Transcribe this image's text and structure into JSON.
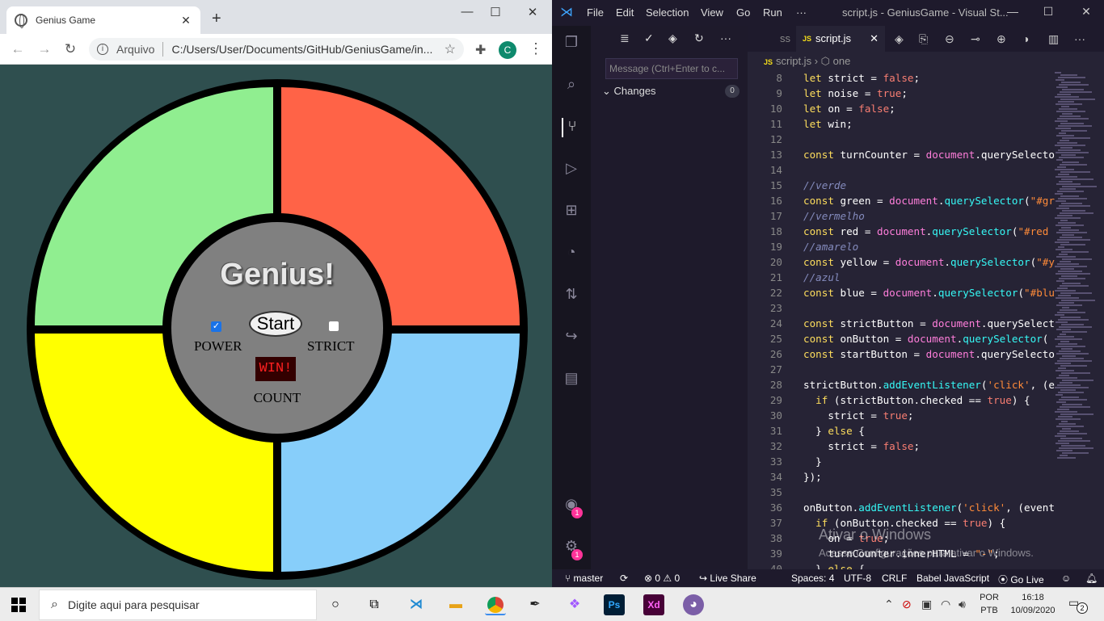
{
  "chrome": {
    "tab_title": "Genius Game",
    "address_scheme": "Arquivo",
    "address_url": "C:/Users/User/Documents/GitHub/GeniusGame/in...",
    "profile_initial": "C"
  },
  "game": {
    "title": "Genius!",
    "start_label": "Start",
    "power_label": "POWER",
    "strict_label": "STRICT",
    "count_display": "WIN!",
    "count_label": "COUNT",
    "power_checked": true,
    "strict_checked": false,
    "colors": {
      "green": "#90ee90",
      "red": "#ff6347",
      "yellow": "#ffff00",
      "blue": "#87cefa",
      "background": "#2f4f4f",
      "center": "#808080"
    }
  },
  "vscode": {
    "menu": [
      "File",
      "Edit",
      "Selection",
      "View",
      "Go",
      "Run",
      "···"
    ],
    "window_title": "script.js - GeniusGame - Visual St...",
    "commit_placeholder": "Message (Ctrl+Enter to c...",
    "changes_label": "Changes",
    "changes_count": "0",
    "prev_tab": "ss",
    "active_tab": "script.js",
    "breadcrumb_file": "script.js",
    "breadcrumb_symbol": "one",
    "watermark_title": "Ativar o Windows",
    "watermark_sub": "Acesse Configurações para ativar o Windows.",
    "status": {
      "branch": "master",
      "problems": "0",
      "warnings": "0",
      "live_share": "Live Share",
      "spaces": "Spaces: 4",
      "encoding": "UTF-8",
      "eol": "CRLF",
      "language": "Babel JavaScript",
      "go_live": "Go Live"
    },
    "code_lines": [
      {
        "n": "8",
        "t": "let strict = false;"
      },
      {
        "n": "9",
        "t": "let noise = true;"
      },
      {
        "n": "10",
        "t": "let on = false;"
      },
      {
        "n": "11",
        "t": "let win;"
      },
      {
        "n": "12",
        "t": ""
      },
      {
        "n": "13",
        "t": "const turnCounter = document.querySelecto"
      },
      {
        "n": "14",
        "t": ""
      },
      {
        "n": "15",
        "t": "//verde"
      },
      {
        "n": "16",
        "t": "const green = document.querySelector(\"#gr"
      },
      {
        "n": "17",
        "t": "//vermelho"
      },
      {
        "n": "18",
        "t": "const red = document.querySelector(\"#red"
      },
      {
        "n": "19",
        "t": "//amarelo"
      },
      {
        "n": "20",
        "t": "const yellow = document.querySelector(\"#y"
      },
      {
        "n": "21",
        "t": "//azul"
      },
      {
        "n": "22",
        "t": "const blue = document.querySelector(\"#blu"
      },
      {
        "n": "23",
        "t": ""
      },
      {
        "n": "24",
        "t": "const strictButton = document.querySelect"
      },
      {
        "n": "25",
        "t": "const onButton = document.querySelector("
      },
      {
        "n": "26",
        "t": "const startButton = document.querySelecto"
      },
      {
        "n": "27",
        "t": ""
      },
      {
        "n": "28",
        "t": "strictButton.addEventListener('click', (e"
      },
      {
        "n": "29",
        "t": "  if (strictButton.checked == true) {"
      },
      {
        "n": "30",
        "t": "    strict = true;"
      },
      {
        "n": "31",
        "t": "  } else {"
      },
      {
        "n": "32",
        "t": "    strict = false;"
      },
      {
        "n": "33",
        "t": "  }"
      },
      {
        "n": "34",
        "t": "});"
      },
      {
        "n": "35",
        "t": ""
      },
      {
        "n": "36",
        "t": "onButton.addEventListener('click', (event"
      },
      {
        "n": "37",
        "t": "  if (onButton.checked == true) {"
      },
      {
        "n": "38",
        "t": "    on = true;"
      },
      {
        "n": "39",
        "t": "    turnCounter.innerHTML = \"-\";"
      },
      {
        "n": "40",
        "t": "  } else {"
      }
    ]
  },
  "taskbar": {
    "search_placeholder": "Digite aqui para pesquisar",
    "lang_top": "POR",
    "lang_bottom": "PTB",
    "time": "16:18",
    "date": "10/09/2020",
    "notifications": "2"
  }
}
